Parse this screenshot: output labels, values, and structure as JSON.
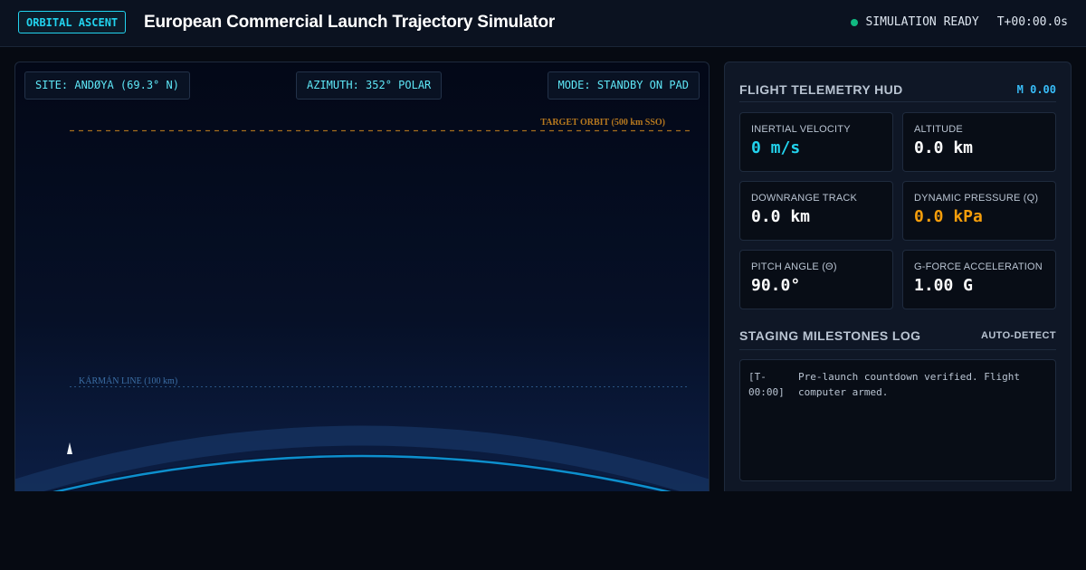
{
  "header": {
    "brand": "ORBITAL ASCENT",
    "title": "European Commercial Launch Trajectory Simulator",
    "status": "SIMULATION READY",
    "clock": "T+00:00.0s"
  },
  "viewport": {
    "site": "SITE: ANDØYA (69.3° N)",
    "azimuth": "AZIMUTH: 352° POLAR",
    "mode": "MODE: STANDBY ON PAD",
    "target_orbit_label": "TARGET ORBIT (500 km SSO)",
    "karman_label": "KÁRMÁN LINE (100 km)"
  },
  "hud": {
    "title": "FLIGHT TELEMETRY HUD",
    "mach": "M 0.00",
    "metrics": [
      {
        "label": "INERTIAL VELOCITY",
        "value": "0 m/s"
      },
      {
        "label": "ALTITUDE",
        "value": "0.0 km"
      },
      {
        "label": "DOWNRANGE TRACK",
        "value": "0.0 km"
      },
      {
        "label": "DYNAMIC PRESSURE (Q)",
        "value": "0.0 kPa"
      },
      {
        "label": "PITCH ANGLE (Θ)",
        "value": "90.0°"
      },
      {
        "label": "G-FORCE ACCELERATION",
        "value": "1.00 G"
      }
    ]
  },
  "log": {
    "title": "STAGING MILESTONES LOG",
    "mode": "AUTO-DETECT",
    "entries": [
      {
        "time": "[T-00:00]",
        "text": "Pre-launch countdown verified. Flight computer armed."
      }
    ]
  },
  "colors": {
    "accent": "#22d3ee",
    "status_ok": "#10b981",
    "warning": "#f59e0b",
    "target_orbit": "#b7791f",
    "karman": "#3b6ea5",
    "earth_limb": "#0ea5e9"
  },
  "icons": {
    "status": "status-dot-icon",
    "vehicle": "rocket-icon"
  }
}
